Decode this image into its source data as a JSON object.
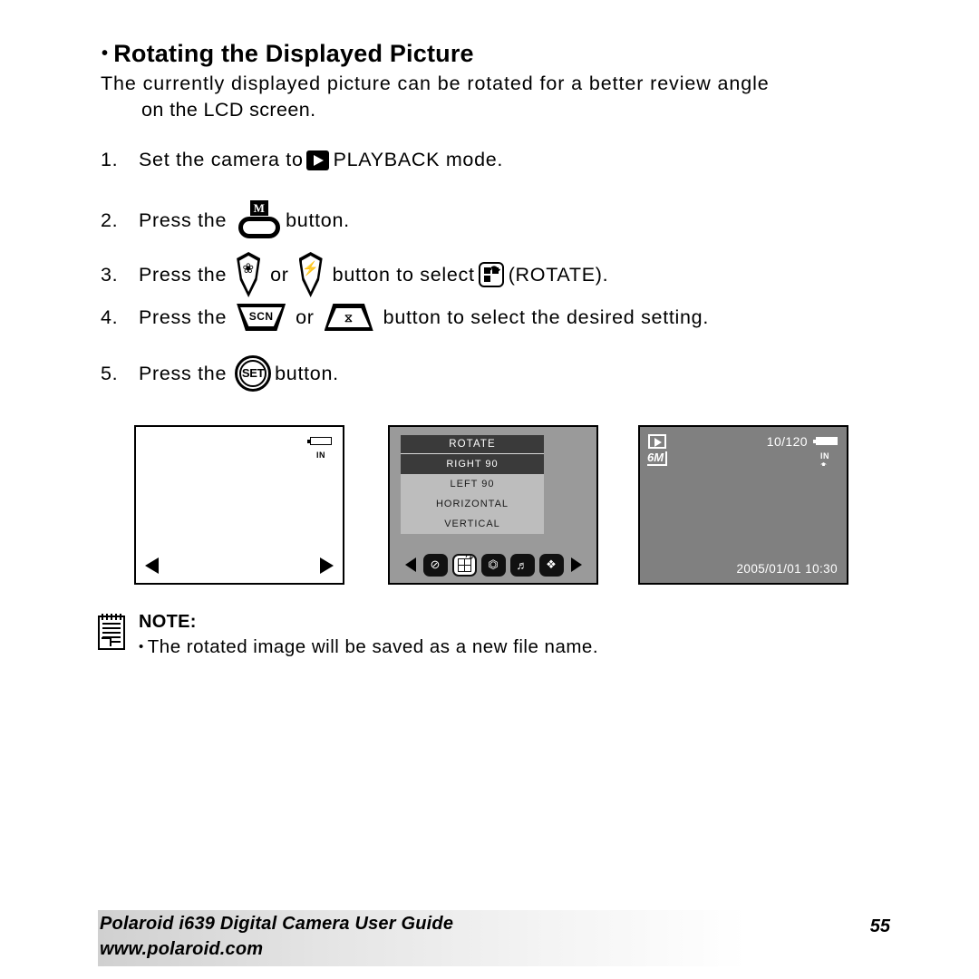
{
  "heading": {
    "bullet": "•",
    "title": "Rotating the Displayed Picture"
  },
  "intro": {
    "line1": "The currently displayed picture can be rotated for a better review angle",
    "line2": "on the LCD screen."
  },
  "steps": [
    {
      "num": "1.",
      "text_before": "Set the camera to",
      "icon": "playback-icon",
      "text_after": "PLAYBACK mode."
    },
    {
      "num": "2.",
      "text_before": "Press the",
      "icon": "menu-m-button-icon",
      "icon_label": "M",
      "text_after": "button."
    },
    {
      "num": "3.",
      "text_before": "Press the",
      "icon_a": "macro-down-button-icon",
      "icon_a_symbol": "❀",
      "conjunction": "or",
      "icon_b": "flash-up-button-icon",
      "icon_b_symbol": "⚡",
      "text_mid": "button to select",
      "icon_c": "rotate-icon",
      "text_after": "(ROTATE)."
    },
    {
      "num": "4.",
      "text_before": "Press the",
      "icon_a": "scn-button-icon",
      "icon_a_label": "SCN",
      "conjunction": "or",
      "icon_b": "self-timer-button-icon",
      "icon_b_symbol": "⧖",
      "text_after": "button to select the desired setting."
    },
    {
      "num": "5.",
      "text_before": "Press the",
      "icon": "set-button-icon",
      "icon_label": "SET",
      "text_after": "button."
    }
  ],
  "screens": {
    "screen1": {
      "name": "blank-preview-screen",
      "background": "#ffffff",
      "battery": "battery-icon",
      "storage_label": "IN",
      "nav_left": "left-arrow-icon",
      "nav_right": "right-arrow-icon"
    },
    "screen2": {
      "name": "rotate-menu-screen",
      "background": "#9a9a9a",
      "panel_bg": "#bdbdbd",
      "title": "ROTATE",
      "title_bg": "#3a3a3a",
      "items": [
        {
          "label": "RIGHT 90",
          "selected": true
        },
        {
          "label": "LEFT 90",
          "selected": false
        },
        {
          "label": "HORIZONTAL",
          "selected": false
        },
        {
          "label": "VERTICAL",
          "selected": false
        }
      ],
      "toolbar": {
        "nav_left": "left-arrow-icon",
        "nav_right": "right-arrow-icon",
        "icons": [
          {
            "name": "delete-icon",
            "glyph": "⊘",
            "active": false
          },
          {
            "name": "rotate-icon",
            "glyph": "grid",
            "active": true
          },
          {
            "name": "resize-icon",
            "glyph": "❐",
            "active": false
          },
          {
            "name": "voice-memo-icon",
            "glyph": "♫",
            "active": false
          },
          {
            "name": "copy-icon",
            "glyph": "❐",
            "active": false
          }
        ]
      }
    },
    "screen3": {
      "name": "playback-result-screen",
      "background": "#808080",
      "mode_icon": "playback-icon",
      "resolution": "6M",
      "counter": "10/120",
      "battery": "battery-icon",
      "storage_label": "IN",
      "timestamp": "2005/01/01 10:30"
    }
  },
  "note": {
    "icon": "notepad-icon",
    "title": "NOTE:",
    "bullet": "•",
    "text": "The rotated image will be saved as a new file name."
  },
  "footer": {
    "line1": "Polaroid i639 Digital Camera User Guide",
    "line2": "www.polaroid.com",
    "page": "55"
  }
}
